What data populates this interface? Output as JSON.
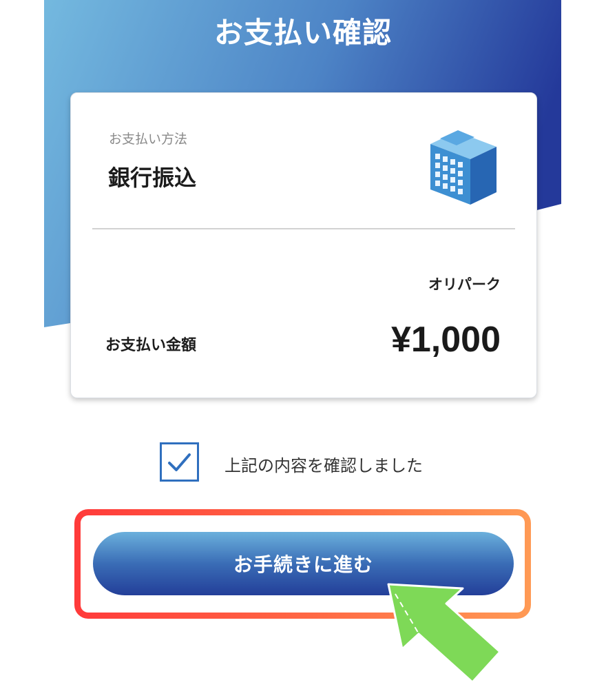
{
  "header": {
    "title": "お支払い確認"
  },
  "card": {
    "payment_method_caption": "お支払い方法",
    "payment_method_value": "銀行振込",
    "payment_method_icon": "bank-building-icon",
    "merchant": "オリパーク",
    "amount_label": "お支払い金額",
    "amount_value": "¥1,000"
  },
  "confirm": {
    "checked": true,
    "label": "上記の内容を確認しました"
  },
  "proceed_button": {
    "label": "お手続きに進む"
  },
  "colors": {
    "header_gradient_start": "#74b9df",
    "header_gradient_end": "#283f9a",
    "accent_blue": "#2f6fbe",
    "highlight_red": "#ff3a3a",
    "highlight_orange": "#ff9a55",
    "pointer_green": "#7ed957"
  }
}
